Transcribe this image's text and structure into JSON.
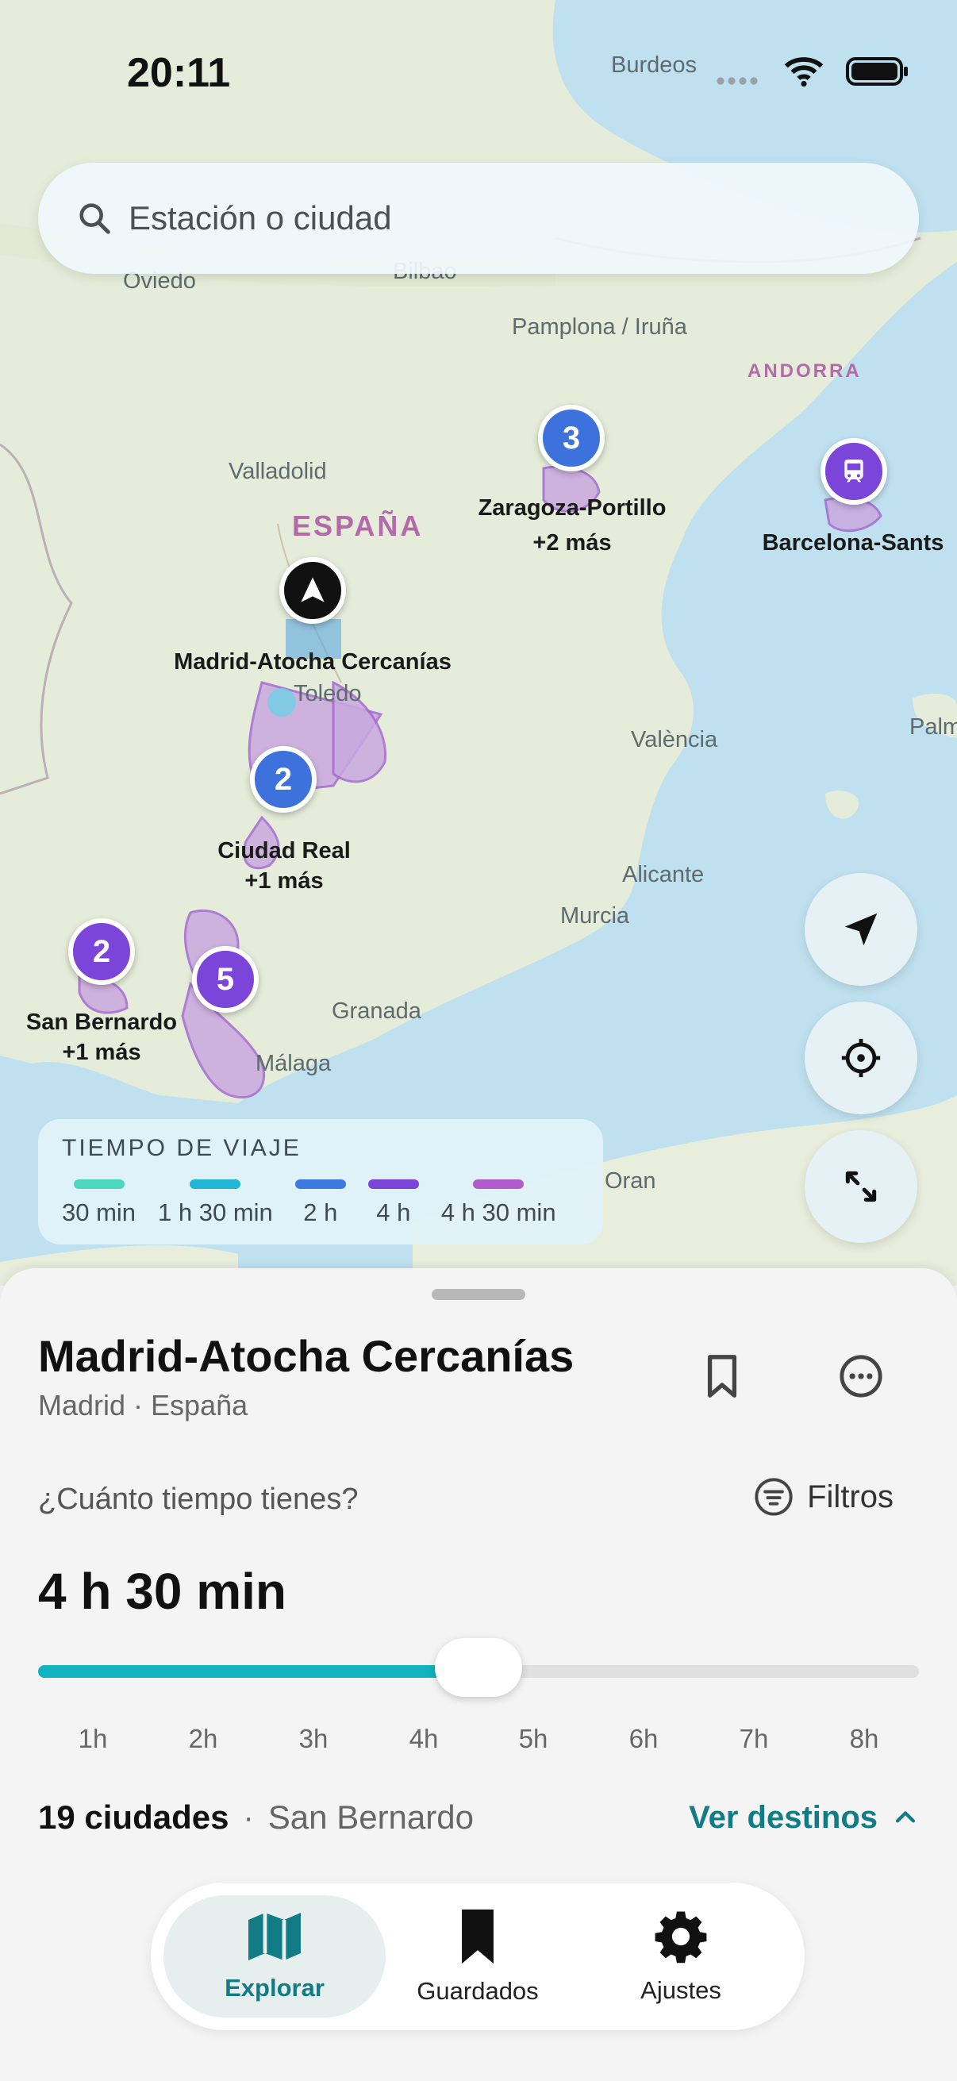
{
  "status_bar": {
    "time": "20:11"
  },
  "search": {
    "placeholder": "Estación o ciudad"
  },
  "map": {
    "place_labels": {
      "burdeos": "Burdeos",
      "oviedo": "Oviedo",
      "bilbao": "Bilbao",
      "pamplona": "Pamplona / Iruña",
      "andorra": "ANDORRA",
      "valladolid": "Valladolid",
      "espana": "ESPAÑA",
      "toledo": "Toledo",
      "valencia": "València",
      "palma": "Palm",
      "alicante": "Alicante",
      "murcia": "Murcia",
      "granada": "Granada",
      "malaga": "Málaga",
      "oran": "Oran"
    },
    "clusters": {
      "zaragoza": {
        "count": "3",
        "name": "Zaragoza-Portillo",
        "more": "+2 más"
      },
      "barcelona": {
        "name": "Barcelona-Sants"
      },
      "madrid": {
        "name": "Madrid-Atocha Cercanías"
      },
      "ciudad_real": {
        "count": "2",
        "name": "Ciudad Real",
        "more": "+1 más"
      },
      "san_bernardo": {
        "count": "2",
        "name": "San Bernardo",
        "more": "+1 más"
      },
      "andalucia": {
        "count": "5"
      }
    }
  },
  "legend": {
    "title": "TIEMPO DE VIAJE",
    "items": [
      "30 min",
      "1 h 30 min",
      "2 h",
      "4 h",
      "4 h 30 min"
    ],
    "colors": [
      "#4dd6c0",
      "#22b6d6",
      "#3f78e0",
      "#7a45d8",
      "#b05ccc"
    ]
  },
  "sheet": {
    "title": "Madrid-Atocha Cercanías",
    "subtitle": "Madrid · España",
    "question": "¿Cuánto tiempo tienes?",
    "filters_label": "Filtros",
    "duration_value": "4 h 30 min",
    "slider": {
      "value_hours": 4.5,
      "min_hours": 0.5,
      "max_hours": 8.5,
      "fill_color": "#11b3c0"
    },
    "ticks": [
      "1h",
      "2h",
      "3h",
      "4h",
      "5h",
      "6h",
      "7h",
      "8h"
    ],
    "cities_count": "19 ciudades",
    "separator": "·",
    "origin": "San Bernardo",
    "see_destinations": "Ver destinos"
  },
  "tabbar": {
    "tabs": [
      {
        "label": "Explorar",
        "icon": "map-icon",
        "active": true
      },
      {
        "label": "Guardados",
        "icon": "bookmark-icon",
        "active": false
      },
      {
        "label": "Ajustes",
        "icon": "gear-icon",
        "active": false
      }
    ]
  },
  "accent_color": "#127c86"
}
